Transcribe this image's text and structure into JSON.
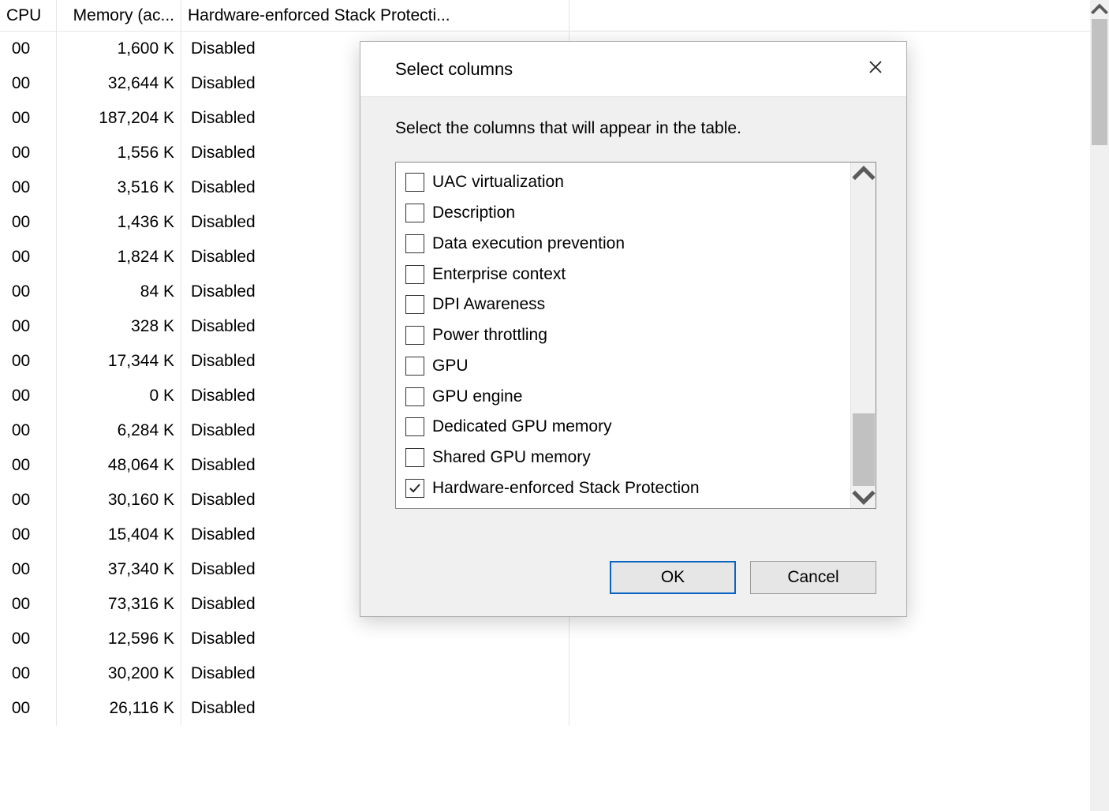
{
  "table": {
    "columns": {
      "cpu": "CPU",
      "memory": "Memory (ac...",
      "hesp": "Hardware-enforced Stack Protecti..."
    },
    "rows": [
      {
        "cpu": "00",
        "memory": "1,600 K",
        "hesp": "Disabled"
      },
      {
        "cpu": "00",
        "memory": "32,644 K",
        "hesp": "Disabled"
      },
      {
        "cpu": "00",
        "memory": "187,204 K",
        "hesp": "Disabled"
      },
      {
        "cpu": "00",
        "memory": "1,556 K",
        "hesp": "Disabled"
      },
      {
        "cpu": "00",
        "memory": "3,516 K",
        "hesp": "Disabled"
      },
      {
        "cpu": "00",
        "memory": "1,436 K",
        "hesp": "Disabled"
      },
      {
        "cpu": "00",
        "memory": "1,824 K",
        "hesp": "Disabled"
      },
      {
        "cpu": "00",
        "memory": "84 K",
        "hesp": "Disabled"
      },
      {
        "cpu": "00",
        "memory": "328 K",
        "hesp": "Disabled"
      },
      {
        "cpu": "00",
        "memory": "17,344 K",
        "hesp": "Disabled"
      },
      {
        "cpu": "00",
        "memory": "0 K",
        "hesp": "Disabled"
      },
      {
        "cpu": "00",
        "memory": "6,284 K",
        "hesp": "Disabled"
      },
      {
        "cpu": "00",
        "memory": "48,064 K",
        "hesp": "Disabled"
      },
      {
        "cpu": "00",
        "memory": "30,160 K",
        "hesp": "Disabled"
      },
      {
        "cpu": "00",
        "memory": "15,404 K",
        "hesp": "Disabled"
      },
      {
        "cpu": "00",
        "memory": "37,340 K",
        "hesp": "Disabled"
      },
      {
        "cpu": "00",
        "memory": "73,316 K",
        "hesp": "Disabled"
      },
      {
        "cpu": "00",
        "memory": "12,596 K",
        "hesp": "Disabled"
      },
      {
        "cpu": "00",
        "memory": "30,200 K",
        "hesp": "Disabled"
      },
      {
        "cpu": "00",
        "memory": "26,116 K",
        "hesp": "Disabled"
      }
    ]
  },
  "dialog": {
    "title": "Select columns",
    "instructions": "Select the columns that will appear in the table.",
    "items": [
      {
        "label": "UAC virtualization",
        "checked": false
      },
      {
        "label": "Description",
        "checked": false
      },
      {
        "label": "Data execution prevention",
        "checked": false
      },
      {
        "label": "Enterprise context",
        "checked": false
      },
      {
        "label": "DPI Awareness",
        "checked": false
      },
      {
        "label": "Power throttling",
        "checked": false
      },
      {
        "label": "GPU",
        "checked": false
      },
      {
        "label": "GPU engine",
        "checked": false
      },
      {
        "label": "Dedicated GPU memory",
        "checked": false
      },
      {
        "label": "Shared GPU memory",
        "checked": false
      },
      {
        "label": "Hardware-enforced Stack Protection",
        "checked": true
      }
    ],
    "ok": "OK",
    "cancel": "Cancel"
  }
}
